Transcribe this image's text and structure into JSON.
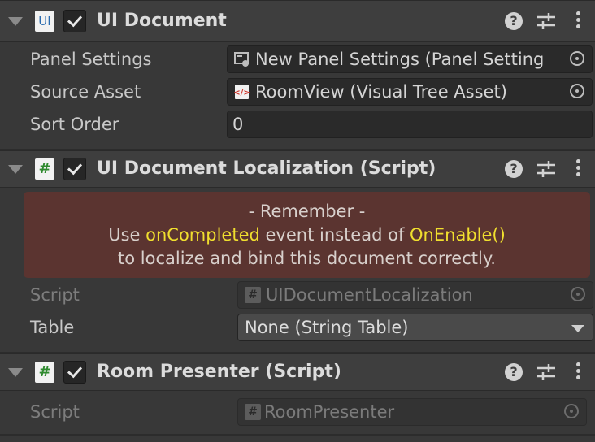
{
  "ui_document": {
    "title": "UI Document",
    "icon": "UI",
    "fields": [
      {
        "label": "Panel Settings",
        "value": "New Panel Settings (Panel Setting"
      },
      {
        "label": "Source Asset",
        "value": "RoomView (Visual Tree Asset)"
      },
      {
        "label": "Sort Order",
        "value": "0"
      }
    ]
  },
  "localization": {
    "title": "UI Document Localization (Script)",
    "icon": "#",
    "help": {
      "line1": "- Remember -",
      "line2_pre": "Use ",
      "line2_hl1": "onCompleted",
      "line2_mid": " event instead of ",
      "line2_hl2": "OnEnable()",
      "line3": "to localize and bind this document correctly."
    },
    "script_label": "Script",
    "script_value": "UIDocumentLocalization",
    "table_label": "Table",
    "table_value": "None (String Table)"
  },
  "room_presenter": {
    "title": "Room Presenter (Script)",
    "icon": "#",
    "script_label": "Script",
    "script_value": "RoomPresenter"
  },
  "icons": {
    "help": "?",
    "colors": {
      "highlight": "#f0df2e",
      "helpbox": "#5b3430",
      "background": "#383838"
    }
  }
}
